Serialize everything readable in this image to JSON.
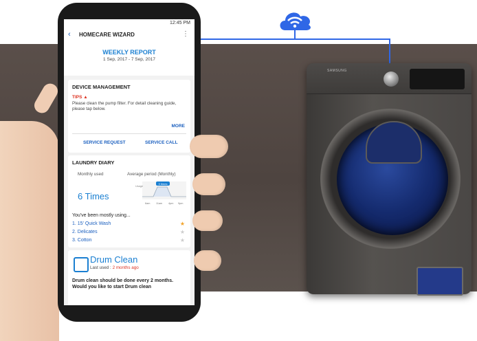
{
  "scene": {
    "accent_color": "#2f67e6",
    "cloud_icon": "wifi-cloud-icon",
    "washer_brand": "SAMSUNG"
  },
  "status_bar": {
    "time": "12:45 PM"
  },
  "app_bar": {
    "title": "HOMECARE WIZARD",
    "back_icon": "chevron-left-icon",
    "menu_icon": "more-vertical-icon"
  },
  "report": {
    "title": "WEEKLY REPORT",
    "date_range": "1 Sep, 2017 - 7 Sep, 2017"
  },
  "device_management": {
    "heading": "DEVICE MANAGEMENT",
    "tips_label": "TIPS",
    "tips_text": "Please clean the pump filter. For detail cleaning guide, please tap below.",
    "more": "MORE",
    "service_request": "SERVICE REQUEST",
    "service_call": "SERVICE CALL"
  },
  "laundry_diary": {
    "heading": "LAUNDRY DIARY",
    "monthly_used_label": "Monthly used",
    "monthly_used_value": "6 Times",
    "average_label": "Average period (Monthly)",
    "chart_axis_label": "Usage",
    "chart_badge": "3 times",
    "chart_ticks": [
      "6am",
      "11am",
      "4pm",
      "9pm"
    ],
    "mostly_label": "You've been mostly using...",
    "items": [
      {
        "label": "1. 15' Quick Wash",
        "starred": true
      },
      {
        "label": "2. Delicates",
        "starred": false
      },
      {
        "label": "3. Cotton",
        "starred": false
      }
    ]
  },
  "drum_clean": {
    "title": "Drum Clean",
    "last_used_label": "Last used :",
    "last_used_value": "2 months ago",
    "body": "Drum clean should be done every 2 months. Would you like to start Drum clean"
  }
}
